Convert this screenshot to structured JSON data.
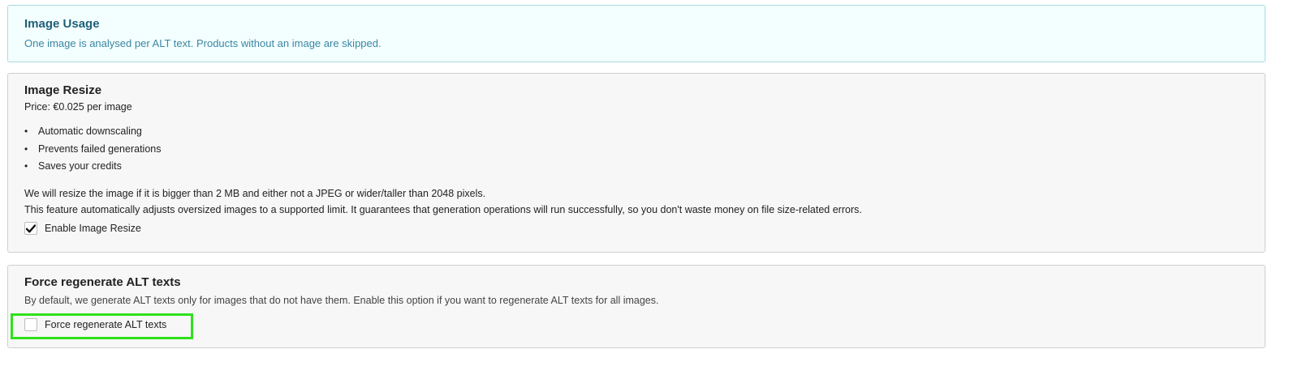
{
  "image_usage": {
    "title": "Image Usage",
    "description": "One image is analysed per ALT text. Products without an image are skipped."
  },
  "image_resize": {
    "title": "Image Resize",
    "price": "Price: €0.025 per image",
    "benefits": [
      "Automatic downscaling",
      "Prevents failed generations",
      "Saves your credits"
    ],
    "note_line1": "We will resize the image if it is bigger than 2 MB and either not a JPEG or wider/taller than 2048 pixels.",
    "note_line2": "This feature automatically adjusts oversized images to a supported limit. It guarantees that generation operations will run successfully, so you don't waste money on file size-related errors.",
    "checkbox_label": "Enable Image Resize",
    "checkbox_checked": true
  },
  "force_regenerate": {
    "title": "Force regenerate ALT texts",
    "description": "By default, we generate ALT texts only for images that do not have them. Enable this option if you want to regenerate ALT texts for all images.",
    "checkbox_label": "Force regenerate ALT texts",
    "checkbox_checked": false,
    "highlight_color": "#2ee11c"
  }
}
